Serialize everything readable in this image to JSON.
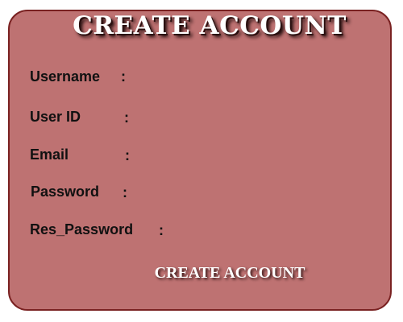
{
  "form": {
    "title": "CREATE ACCOUNT",
    "fields": [
      {
        "label": "Username",
        "colon": ":",
        "value": "",
        "placeholder": ""
      },
      {
        "label": "User ID",
        "colon": ":",
        "value": "",
        "placeholder": ""
      },
      {
        "label": "Email",
        "colon": ":",
        "value": "",
        "placeholder": ""
      },
      {
        "label": "Password",
        "colon": ":",
        "value": "",
        "placeholder": ""
      },
      {
        "label": "Res_Password",
        "colon": ":",
        "value": "",
        "placeholder": ""
      }
    ],
    "submit_label": "CREATE ACCOUNT"
  },
  "colors": {
    "card_background": "#be7272",
    "card_border": "#7a2222",
    "title_text": "#ffffff",
    "label_text": "#111111"
  }
}
